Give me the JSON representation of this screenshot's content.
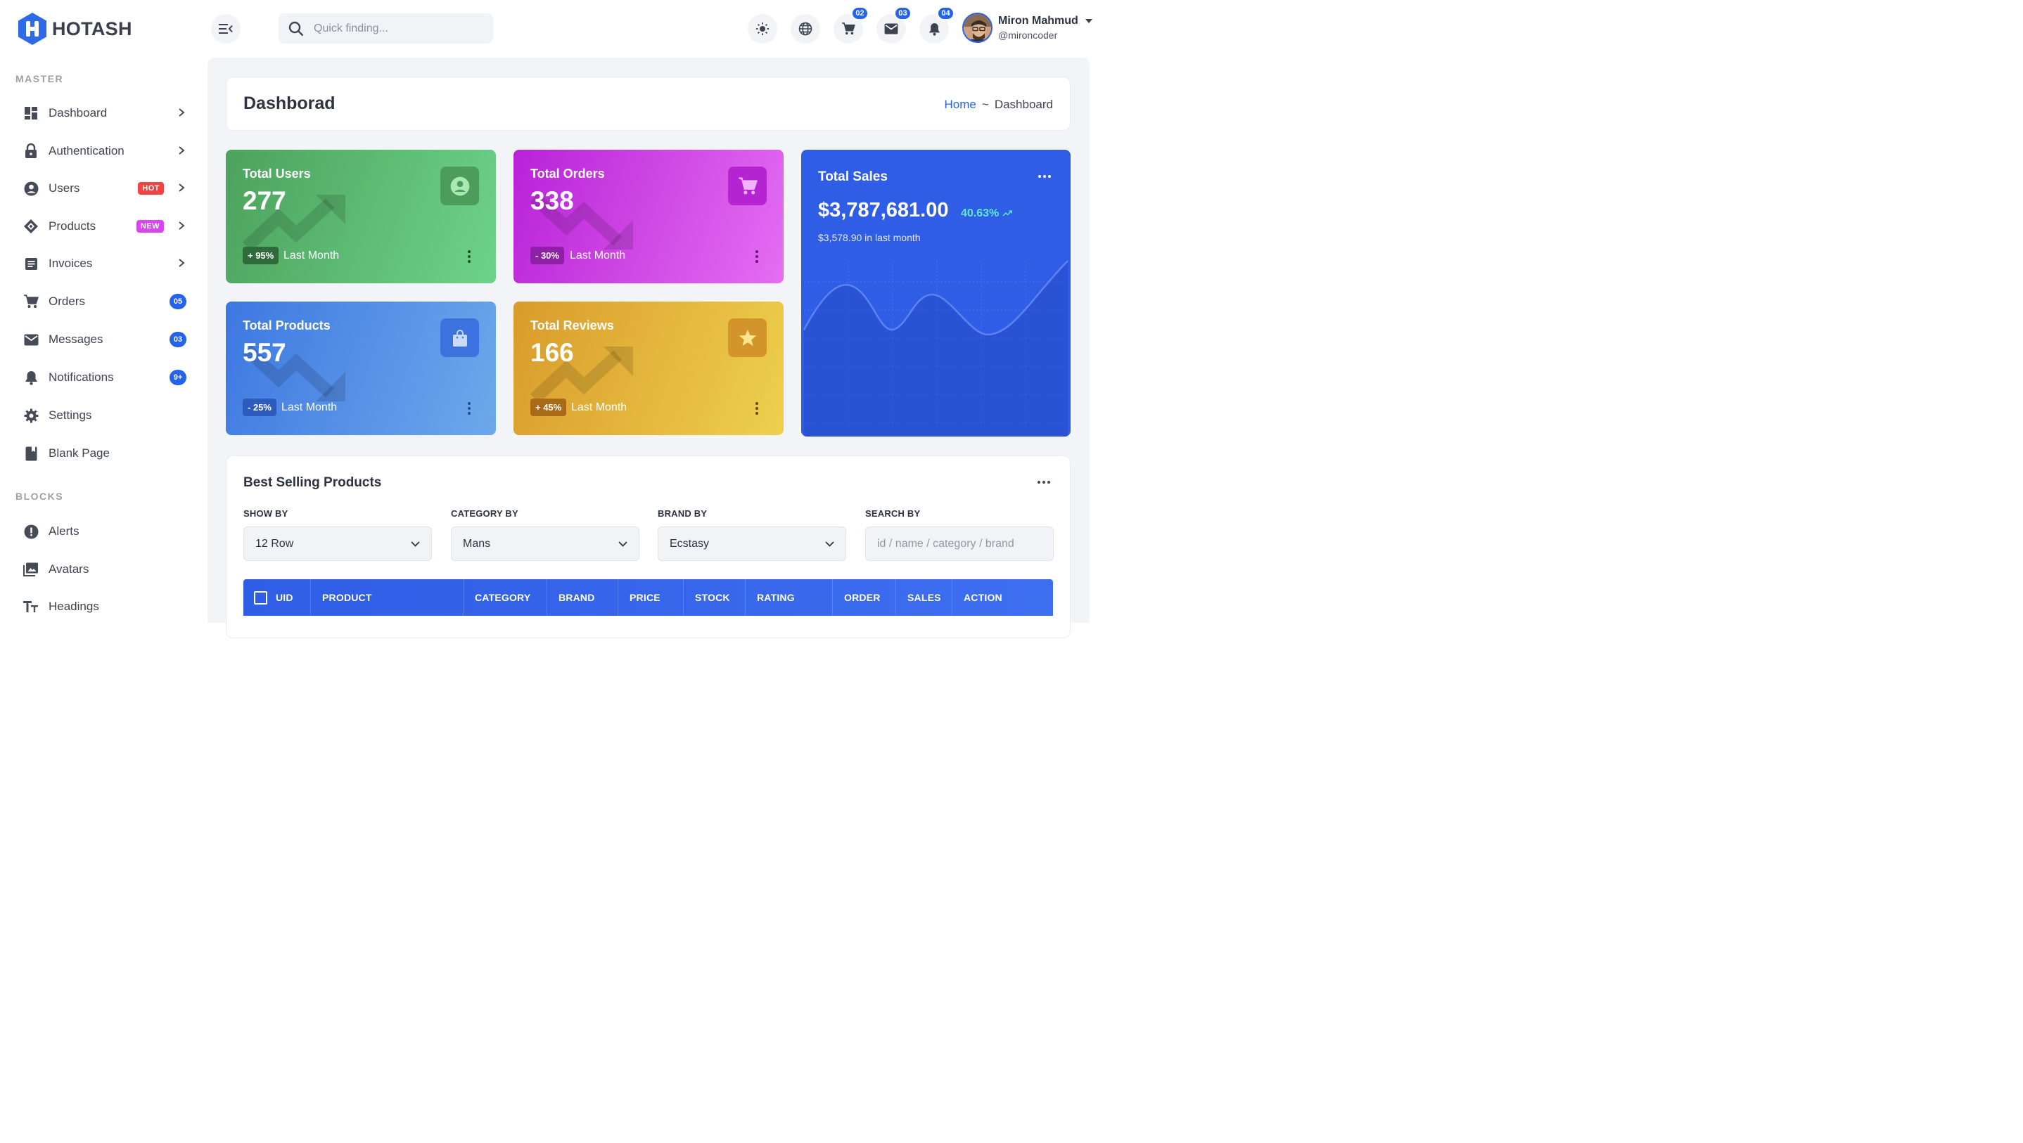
{
  "brand": {
    "name": "HOTASH",
    "color": "#2563eb"
  },
  "colors": {
    "primary": "#2563eb",
    "hot": "#ef4444",
    "new": "#d946ef",
    "positive": "#5eead4"
  },
  "sidebar": {
    "sections": [
      {
        "title": "MASTER"
      },
      {
        "title": "BLOCKS"
      }
    ],
    "master_items": [
      {
        "label": "Dashboard",
        "icon": "dashboard-icon",
        "chevron": true
      },
      {
        "label": "Authentication",
        "icon": "lock-icon",
        "chevron": true
      },
      {
        "label": "Users",
        "icon": "user-circle-icon",
        "chevron": true,
        "badge": "HOT"
      },
      {
        "label": "Products",
        "icon": "diamond-icon",
        "chevron": true,
        "badge": "NEW"
      },
      {
        "label": "Invoices",
        "icon": "invoice-icon",
        "chevron": true
      },
      {
        "label": "Orders",
        "icon": "cart-icon",
        "count": "05"
      },
      {
        "label": "Messages",
        "icon": "mail-icon",
        "count": "03"
      },
      {
        "label": "Notifications",
        "icon": "bell-icon",
        "count": "9+"
      },
      {
        "label": "Settings",
        "icon": "gear-icon"
      },
      {
        "label": "Blank Page",
        "icon": "book-icon"
      }
    ],
    "block_items": [
      {
        "label": "Alerts",
        "icon": "alert-icon"
      },
      {
        "label": "Avatars",
        "icon": "image-icon"
      },
      {
        "label": "Headings",
        "icon": "text-icon"
      }
    ]
  },
  "header": {
    "search": {
      "placeholder": "Quick finding..."
    },
    "cart_count": "02",
    "mail_count": "03",
    "bell_count": "04",
    "user": {
      "name": "Miron Mahmud",
      "handle": "@mironcoder"
    }
  },
  "page": {
    "title": "Dashborad",
    "breadcrumb": {
      "home": "Home",
      "separator": "~",
      "current": "Dashboard"
    }
  },
  "stats": [
    {
      "title": "Total Users",
      "value": "277",
      "change": "+ 95%",
      "period": "Last Month",
      "icon": "user-circle-icon",
      "trend": "up"
    },
    {
      "title": "Total Orders",
      "value": "338",
      "change": "- 30%",
      "period": "Last Month",
      "icon": "cart-icon",
      "trend": "down"
    },
    {
      "title": "Total Products",
      "value": "557",
      "change": "- 25%",
      "period": "Last Month",
      "icon": "shopping-bag-icon",
      "trend": "down"
    },
    {
      "title": "Total Reviews",
      "value": "166",
      "change": "+ 45%",
      "period": "Last Month",
      "icon": "star-icon",
      "trend": "up"
    }
  ],
  "sales": {
    "title": "Total Sales",
    "value": "$3,787,681.00",
    "change": "40.63%",
    "subtitle": "$3,578.90 in last month",
    "trend_icon": "trending-up-icon"
  },
  "best_selling": {
    "title": "Best Selling Products",
    "filters": [
      {
        "label": "SHOW BY",
        "value": "12 Row"
      },
      {
        "label": "CATEGORY BY",
        "value": "Mans"
      },
      {
        "label": "BRAND BY",
        "value": "Ecstasy"
      },
      {
        "label": "SEARCH BY",
        "placeholder": "id / name / category / brand"
      }
    ],
    "columns": [
      "UID",
      "PRODUCT",
      "CATEGORY",
      "BRAND",
      "PRICE",
      "STOCK",
      "RATING",
      "ORDER",
      "SALES",
      "ACTION"
    ]
  }
}
